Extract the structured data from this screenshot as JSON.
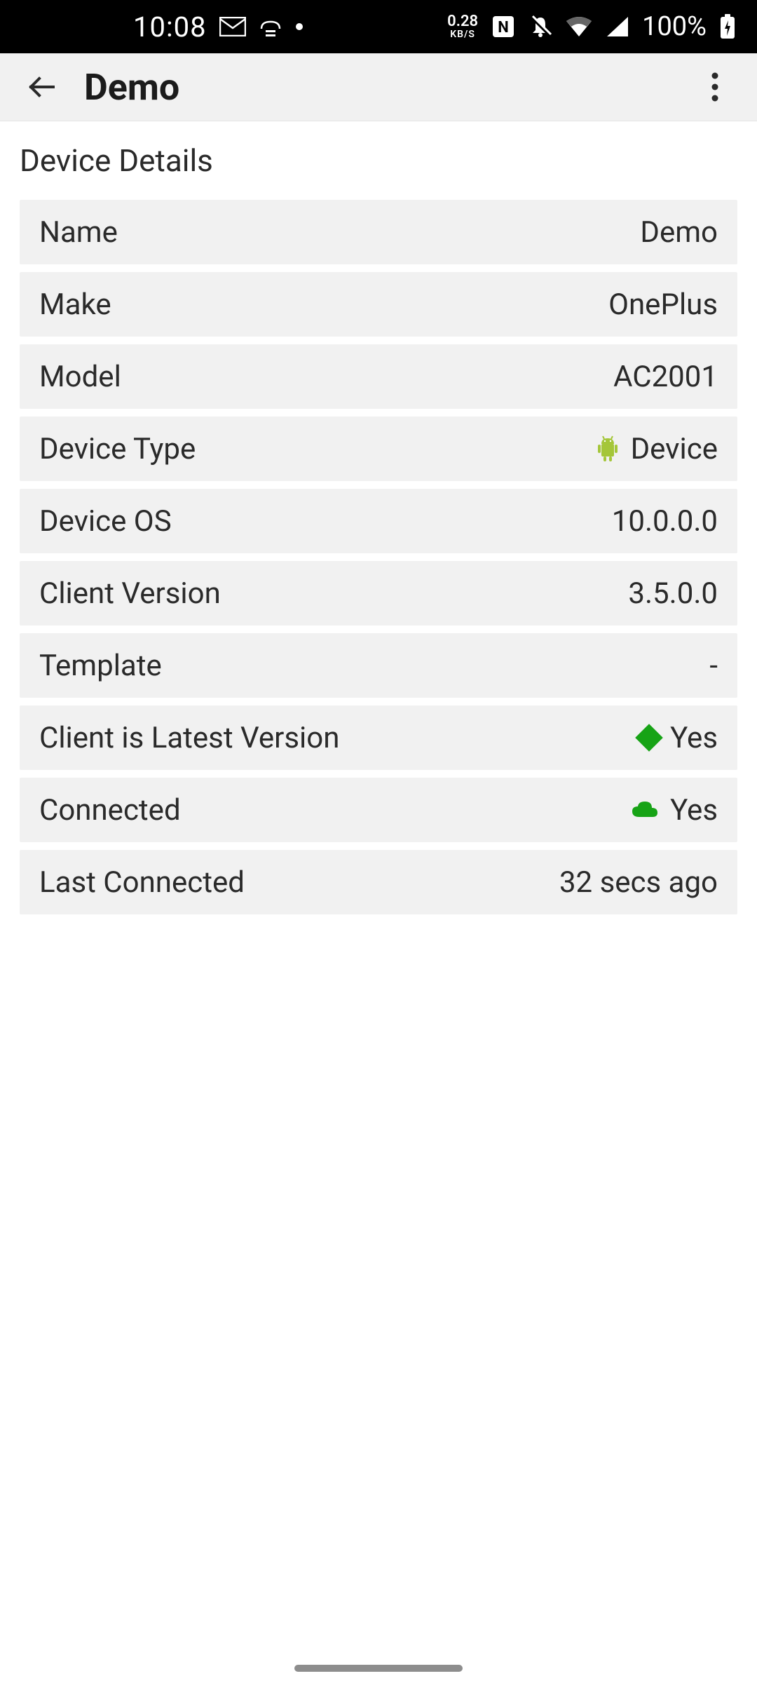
{
  "status": {
    "time": "10:08",
    "kbps_value": "0.28",
    "kbps_unit": "KB/S",
    "battery": "100%"
  },
  "appbar": {
    "title": "Demo"
  },
  "section": {
    "title": "Device Details"
  },
  "details": {
    "name_label": "Name",
    "name_value": "Demo",
    "make_label": "Make",
    "make_value": "OnePlus",
    "model_label": "Model",
    "model_value": "AC2001",
    "device_type_label": "Device Type",
    "device_type_value": "Device",
    "device_os_label": "Device OS",
    "device_os_value": "10.0.0.0",
    "client_version_label": "Client Version",
    "client_version_value": "3.5.0.0",
    "template_label": "Template",
    "template_value": "-",
    "latest_label": "Client is Latest Version",
    "latest_value": "Yes",
    "connected_label": "Connected",
    "connected_value": "Yes",
    "last_connected_label": "Last Connected",
    "last_connected_value": "32 secs ago"
  },
  "colors": {
    "accent_green": "#17a316",
    "android_green": "#a4c639"
  }
}
